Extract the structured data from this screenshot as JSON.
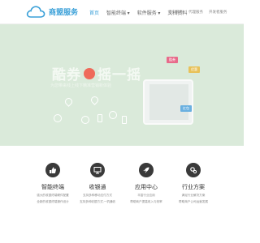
{
  "header": {
    "logo_text": "商盟服务",
    "nav": [
      "首页",
      "智能终端 ▾",
      "软件服务 ▾",
      "文档资料"
    ],
    "top_links": [
      "商户服务",
      "代理服务",
      "开发者服务"
    ]
  },
  "banner": {
    "headline_left": "酷券",
    "headline_right": "摇一摇",
    "subline": "为您带来线上线下精准营销新体验",
    "tags": [
      "酷券",
      "优惠",
      "红包"
    ]
  },
  "features": [
    {
      "icon": "thumbs-up-icon",
      "title": "智能终端",
      "desc": [
        "强大的收银终端硬件配置",
        "全新的收银终端操作设计"
      ]
    },
    {
      "icon": "monitor-icon",
      "title": "收银通",
      "desc": [
        "支持多种移动支付方式",
        "支持多种收银方式,一机通收"
      ]
    },
    {
      "icon": "rocket-icon",
      "title": "应用中心",
      "desc": [
        "丰富行业应用",
        "帮助商户提高收入与效率"
      ]
    },
    {
      "icon": "gears-icon",
      "title": "行业方案",
      "desc": [
        "满足行业解决方案",
        "帮助商户公司运营发展"
      ]
    }
  ],
  "colors": {
    "accent": "#3aa0d8",
    "banner_bg": "#d5e8d5",
    "icon_bg": "#3a3a3a"
  }
}
